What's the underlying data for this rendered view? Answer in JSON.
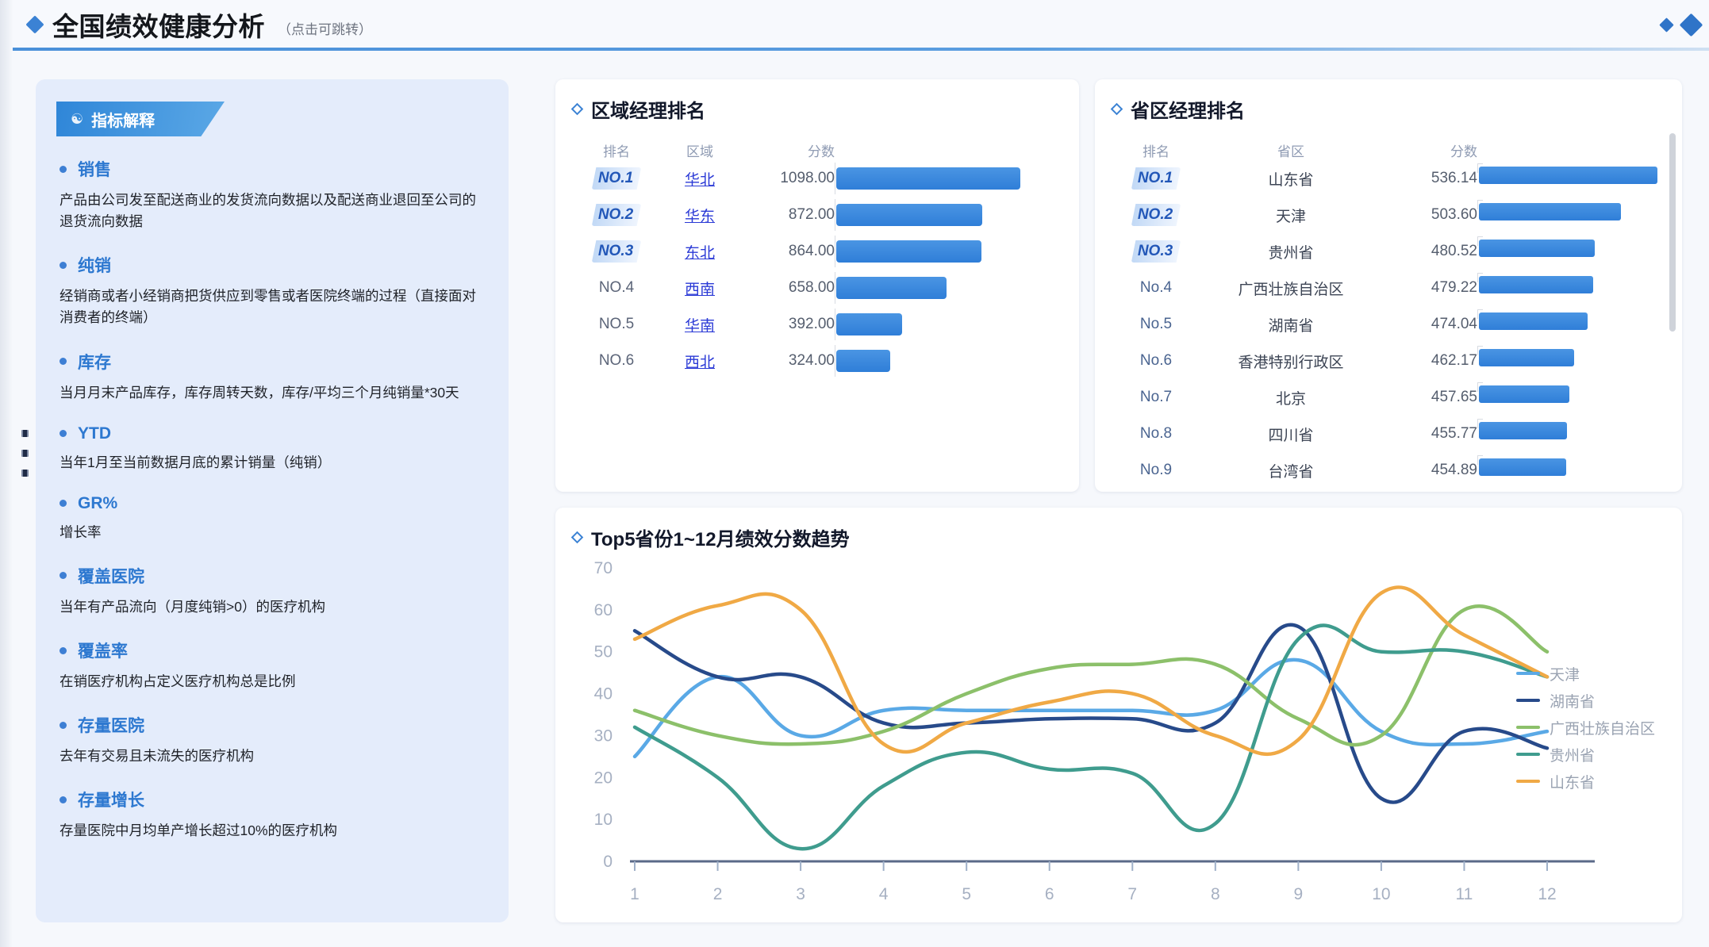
{
  "header": {
    "title": "全国绩效健康分析",
    "subtitle": "（点击可跳转）",
    "diamond_icon": "diamond-icon",
    "accent_color": "#3b82d4"
  },
  "sidebar": {
    "ribbon_label": "指标解释",
    "ribbon_icon": "lightbulb-icon",
    "metrics": [
      {
        "name": "销售",
        "desc": "产品由公司发至配送商业的发货流向数据以及配送商业退回至公司的退货流向数据"
      },
      {
        "name": "纯销",
        "desc": "经销商或者小经销商把货供应到零售或者医院终端的过程（直接面对消费者的终端）"
      },
      {
        "name": "库存",
        "desc": "当月月末产品库存，库存周转天数，库存/平均三个月纯销量*30天"
      },
      {
        "name": "YTD",
        "desc": "当年1月至当前数据月底的累计销量（纯销）"
      },
      {
        "name": "GR%",
        "desc": "增长率"
      },
      {
        "name": "覆盖医院",
        "desc": "当年有产品流向（月度纯销>0）的医疗机构"
      },
      {
        "name": "覆盖率",
        "desc": "在销医疗机构占定义医疗机构总是比例"
      },
      {
        "name": "存量医院",
        "desc": "去年有交易且未流失的医疗机构"
      },
      {
        "name": "存量增长",
        "desc": "存量医院中月均单产增长超过10%的医疗机构"
      }
    ]
  },
  "region_panel": {
    "title": "区域经理排名",
    "columns": [
      "排名",
      "区域",
      "分数"
    ],
    "rows": [
      {
        "rank": "NO.1",
        "top": true,
        "name": "华北",
        "score": "1098.00",
        "value": 1098
      },
      {
        "rank": "NO.2",
        "top": true,
        "name": "华东",
        "score": "872.00",
        "value": 872
      },
      {
        "rank": "NO.3",
        "top": true,
        "name": "东北",
        "score": "864.00",
        "value": 864
      },
      {
        "rank": "NO.4",
        "top": false,
        "name": "西南",
        "score": "658.00",
        "value": 658
      },
      {
        "rank": "NO.5",
        "top": false,
        "name": "华南",
        "score": "392.00",
        "value": 392
      },
      {
        "rank": "NO.6",
        "top": false,
        "name": "西北",
        "score": "324.00",
        "value": 324
      }
    ]
  },
  "province_panel": {
    "title": "省区经理排名",
    "columns": [
      "排名",
      "省区",
      "分数"
    ],
    "rows": [
      {
        "rank": "NO.1",
        "top": true,
        "name": "山东省",
        "score": "536.14",
        "value": 536.14
      },
      {
        "rank": "NO.2",
        "top": true,
        "name": "天津",
        "score": "503.60",
        "value": 503.6
      },
      {
        "rank": "NO.3",
        "top": true,
        "name": "贵州省",
        "score": "480.52",
        "value": 480.52
      },
      {
        "rank": "No.4",
        "top": false,
        "name": "广西壮族自治区",
        "score": "479.22",
        "value": 479.22
      },
      {
        "rank": "No.5",
        "top": false,
        "name": "湖南省",
        "score": "474.04",
        "value": 474.04
      },
      {
        "rank": "No.6",
        "top": false,
        "name": "香港特别行政区",
        "score": "462.17",
        "value": 462.17
      },
      {
        "rank": "No.7",
        "top": false,
        "name": "北京",
        "score": "457.65",
        "value": 457.65
      },
      {
        "rank": "No.8",
        "top": false,
        "name": "四川省",
        "score": "455.77",
        "value": 455.77
      },
      {
        "rank": "No.9",
        "top": false,
        "name": "台湾省",
        "score": "454.89",
        "value": 454.89
      }
    ]
  },
  "chart_data": {
    "type": "line",
    "title": "Top5省份1~12月绩效分数趋势",
    "xlabel": "",
    "ylabel": "",
    "x": [
      1,
      2,
      3,
      4,
      5,
      6,
      7,
      8,
      9,
      10,
      11,
      12
    ],
    "xtick_labels": [
      "1",
      "2",
      "3",
      "4",
      "5",
      "6",
      "7",
      "8",
      "9",
      "10",
      "11",
      "12"
    ],
    "ytick_labels": [
      "0",
      "10",
      "20",
      "30",
      "40",
      "50",
      "60",
      "70"
    ],
    "ylim": [
      0,
      70
    ],
    "xlim": [
      1,
      12
    ],
    "grid": false,
    "legend_position": "right",
    "series": [
      {
        "name": "天津",
        "color": "#5aa9e6",
        "values": [
          25,
          44,
          30,
          36,
          36,
          36,
          36,
          36,
          48,
          31,
          28,
          31
        ]
      },
      {
        "name": "湖南省",
        "color": "#274a8a",
        "values": [
          55,
          44,
          44,
          33,
          33,
          34,
          34,
          33,
          56,
          15,
          31,
          27
        ]
      },
      {
        "name": "广西壮族自治区",
        "color": "#8cc06a",
        "values": [
          36,
          30,
          28,
          31,
          40,
          46,
          47,
          47,
          34,
          30,
          60,
          50
        ]
      },
      {
        "name": "贵州省",
        "color": "#3f9c8e",
        "values": [
          32,
          20,
          3,
          18,
          26,
          22,
          21,
          9,
          53,
          50,
          50,
          44
        ]
      },
      {
        "name": "山东省",
        "color": "#f0a945",
        "values": [
          53,
          61,
          60,
          28,
          33,
          38,
          40,
          30,
          29,
          64,
          54,
          44
        ]
      }
    ]
  }
}
